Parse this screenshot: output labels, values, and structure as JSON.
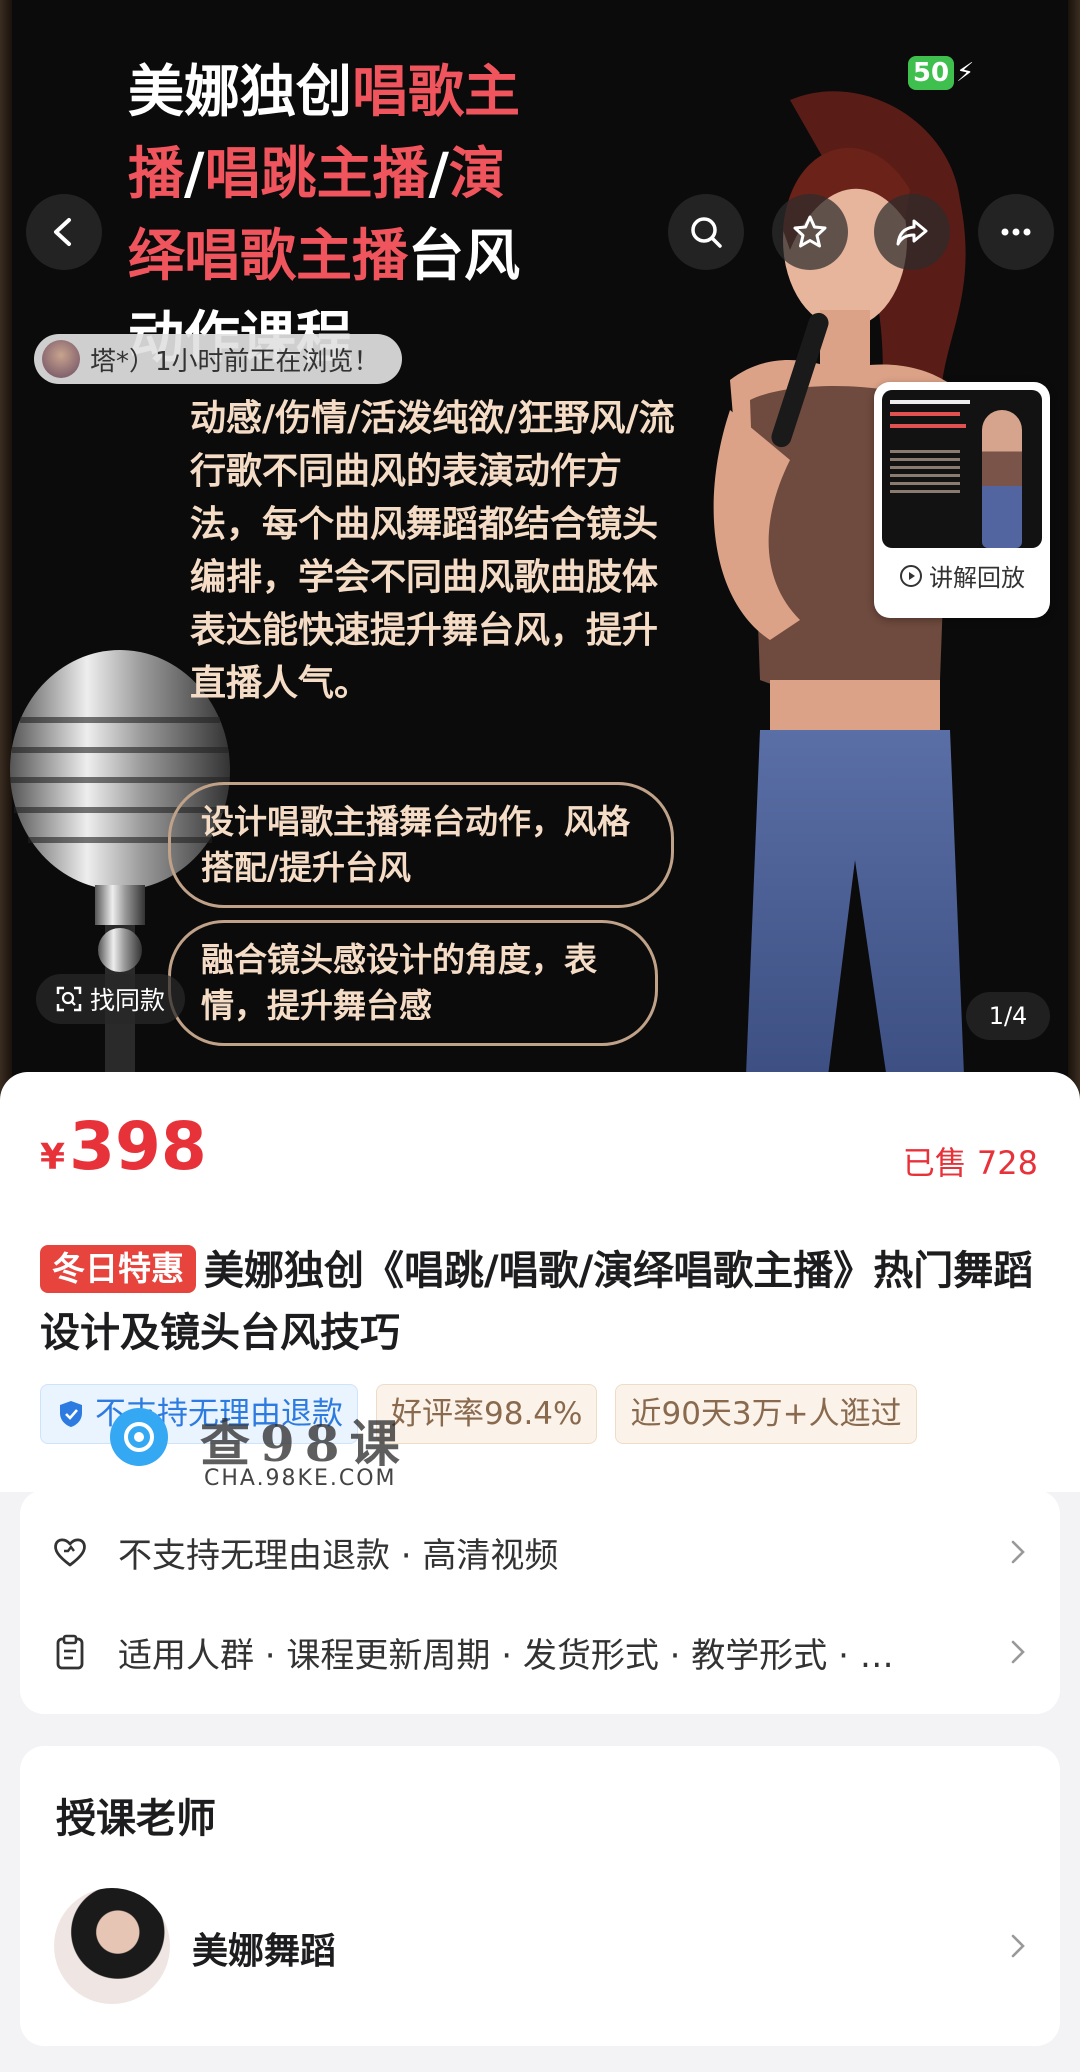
{
  "banner": {
    "headline": {
      "line1_white": "美娜独创",
      "line1_red": "唱歌主",
      "line2_red": "播",
      "line2_white": "/",
      "line2_red2": "唱跳主播",
      "line2_white2": "/",
      "line2_red3": "演",
      "line3_red": "绎唱歌主播",
      "line3_white": "台风",
      "line4_white": "动作课程"
    },
    "battery": "50",
    "browse_text": "塔*）1小时前正在浏览！",
    "description": "动感/伤情/活泼纯欲/狂野风/流行歌不同曲风的表演动作方法，每个曲风舞蹈都结合镜头编排，学会不同曲风歌曲肢体表达能快速提升舞台风，提升直播人气。",
    "pill1": "设计唱歌主播舞台动作，风格搭配/提升台风",
    "pill2": "融合镜头感设计的角度，表情，提升舞台感",
    "find_same": "找同款",
    "replay_label": "讲解回放",
    "page_indicator": "1/4"
  },
  "product": {
    "currency": "¥",
    "price": "398",
    "sold": "已售 728",
    "promo_badge": "冬日特惠",
    "title": "美娜独创《唱跳/唱歌/演绎唱歌主播》热门舞蹈设计及镜头台风技巧",
    "tags": {
      "refund": "不支持无理由退款",
      "rating": "好评率98.4%",
      "visits": "近90天3万+人逛过"
    }
  },
  "watermark": {
    "text": "查98课",
    "sub": "CHA.98KE.COM"
  },
  "attributes": {
    "row1": "不支持无理由退款 · 高清视频",
    "row2": "适用人群 · 课程更新周期 · 发货形式 · 教学形式 · …"
  },
  "teacher": {
    "heading": "授课老师",
    "name": "美娜舞蹈"
  },
  "colors": {
    "price_red": "#e8323a",
    "promo_red": "#e8443e",
    "headline_red": "#f0545c",
    "refund_blue": "#2d7be0"
  }
}
